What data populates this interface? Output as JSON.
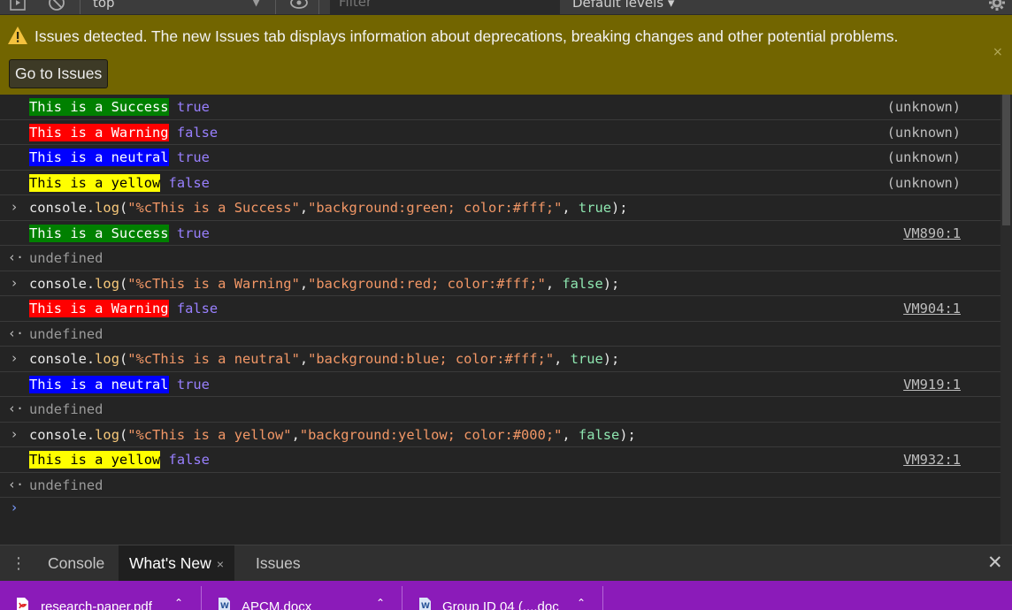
{
  "toolbar": {
    "context": "top",
    "filter_placeholder": "Filter",
    "levels": "Default levels ▾",
    "icons": [
      "sidebar-toggle-icon",
      "clear-console-icon",
      "eye-icon",
      "gear-icon"
    ]
  },
  "banner": {
    "message": "Issues detected. The new Issues tab displays information about deprecations, breaking changes and other potential problems.",
    "button": "Go to Issues",
    "close": "×",
    "color": "#726500"
  },
  "log": {
    "entries": [
      {
        "kind": "output",
        "tag": "This is a Success",
        "bool": "true",
        "source": "(unknown)"
      },
      {
        "kind": "output",
        "tag": "This is a Warning",
        "bool": "false",
        "source": "(unknown)"
      },
      {
        "kind": "output",
        "tag": "This is a neutral",
        "bool": "true",
        "source": "(unknown)"
      },
      {
        "kind": "output",
        "tag": "This is a yellow",
        "bool": "false",
        "source": "(unknown)"
      },
      {
        "kind": "input",
        "obj": "console",
        "dot": ".",
        "fn": "log",
        "open": "(",
        "str1": "\"%cThis is a Success\"",
        "comma1": ",",
        "str2": "\"background:green; color:#fff;\"",
        "comma2": ", ",
        "arg": "true",
        "close": ");"
      },
      {
        "kind": "output",
        "tag": "This is a Success",
        "bool": "true",
        "source": "VM890:1"
      },
      {
        "kind": "result",
        "text": "undefined"
      },
      {
        "kind": "input",
        "obj": "console",
        "dot": ".",
        "fn": "log",
        "open": "(",
        "str1": "\"%cThis is a Warning\"",
        "comma1": ",",
        "str2": "\"background:red; color:#fff;\"",
        "comma2": ", ",
        "arg": "false",
        "close": ");"
      },
      {
        "kind": "output",
        "tag": "This is a Warning",
        "bool": "false",
        "source": "VM904:1"
      },
      {
        "kind": "result",
        "text": "undefined"
      },
      {
        "kind": "input",
        "obj": "console",
        "dot": ".",
        "fn": "log",
        "open": "(",
        "str1": "\"%cThis is a neutral\"",
        "comma1": ",",
        "str2": "\"background:blue; color:#fff;\"",
        "comma2": ", ",
        "arg": "true",
        "close": ");"
      },
      {
        "kind": "output",
        "tag": "This is a neutral",
        "bool": "true",
        "source": "VM919:1"
      },
      {
        "kind": "result",
        "text": "undefined"
      },
      {
        "kind": "input",
        "obj": "console",
        "dot": ".",
        "fn": "log",
        "open": "(",
        "str1": "\"%cThis is a yellow\"",
        "comma1": ",",
        "str2": "\"background:yellow; color:#000;\"",
        "comma2": ", ",
        "arg": "false",
        "close": ");"
      },
      {
        "kind": "output",
        "tag": "This is a yellow",
        "bool": "false",
        "source": "VM932:1"
      },
      {
        "kind": "result",
        "text": "undefined"
      }
    ],
    "prompt": "›"
  },
  "drawer": {
    "tabs": [
      {
        "label": "Console"
      },
      {
        "label": "What's New",
        "close": "×"
      },
      {
        "label": "Issues"
      }
    ],
    "close": "✕"
  },
  "downloads": {
    "items": [
      {
        "name": "research-paper.pdf",
        "icon": "pdf-file-icon"
      },
      {
        "name": "APCM.docx",
        "icon": "word-file-icon"
      },
      {
        "name": "Group ID 04 (....doc",
        "icon": "word-file-icon"
      }
    ],
    "color": "#8b1bb9"
  }
}
